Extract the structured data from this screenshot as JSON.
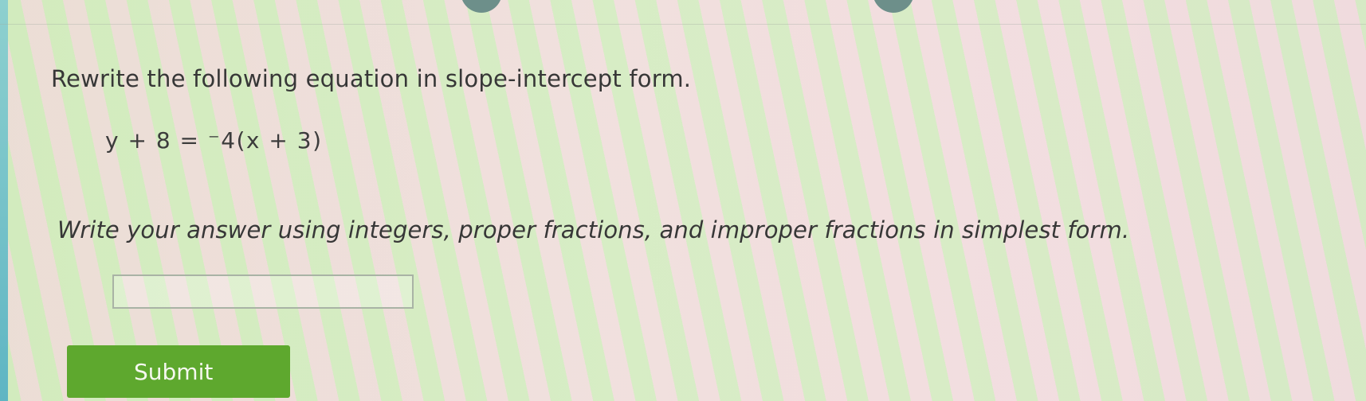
{
  "question": {
    "prompt": "Rewrite the following equation in slope-intercept form.",
    "equation": "y + 8 = ⁻4(x + 3)",
    "instructions": "Write your answer using integers, proper fractions, and improper fractions in simplest form."
  },
  "answer": {
    "value": ""
  },
  "submit": {
    "label": "Submit",
    "color": "#5ea82e"
  },
  "theme": {
    "accent_left_edge": "#6cc0c8"
  }
}
